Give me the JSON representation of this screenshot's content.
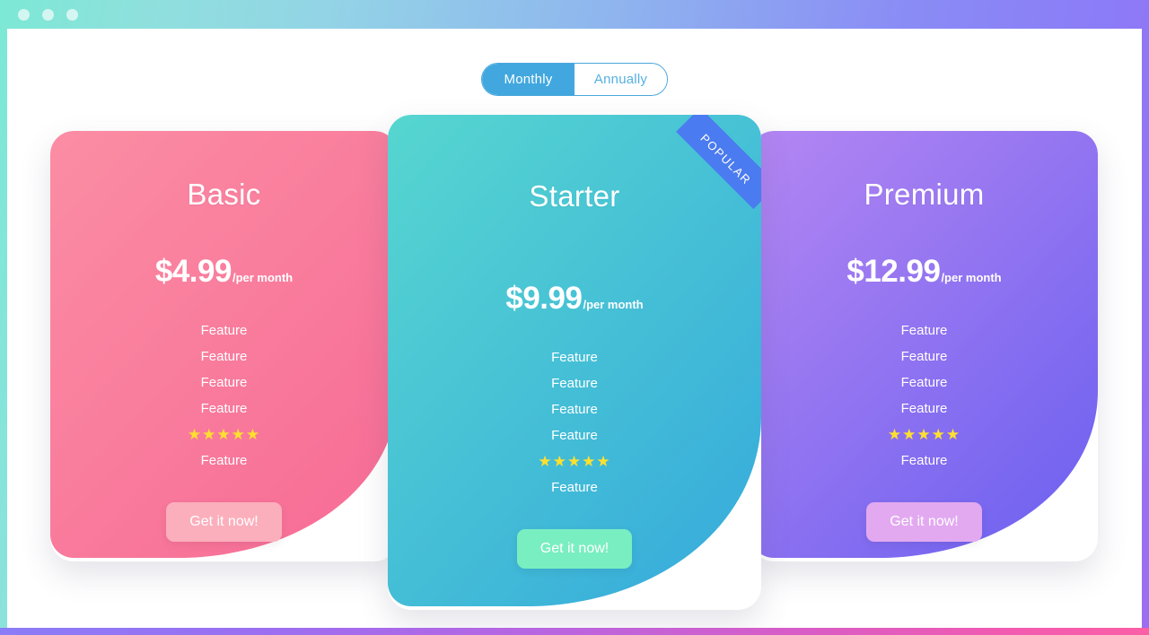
{
  "window": {
    "dots": [
      "close-dot",
      "minimize-dot",
      "maximize-dot"
    ],
    "chrome_gradient_start": "#7ce8d5",
    "chrome_gradient_end": "#9b6ef0",
    "bottom_strip_start": "#8b7cf7",
    "bottom_strip_end": "#fb5fa6"
  },
  "billing_toggle": {
    "options": [
      {
        "label": "Monthly",
        "active": true
      },
      {
        "label": "Annually",
        "active": false
      }
    ],
    "active_color": "#41a7de",
    "inactive_text_color": "#55b0e0"
  },
  "ribbon": {
    "label": "POPULAR",
    "color": "#4a7bf0",
    "text_color": "#ffffff"
  },
  "plans": [
    {
      "id": "basic",
      "title": "Basic",
      "price": "$4.99",
      "period": "/per month",
      "features": [
        "Feature",
        "Feature",
        "Feature",
        "Feature"
      ],
      "rating_stars": 5,
      "star_glyph": "★",
      "feature_after_rating": "Feature",
      "cta_label": "Get it now!",
      "blob_color_start": "#fb8da4",
      "blob_color_end": "#f76d96",
      "cta_color": "#fbafbc",
      "popular": false
    },
    {
      "id": "starter",
      "title": "Starter",
      "price": "$9.99",
      "period": "/per month",
      "features": [
        "Feature",
        "Feature",
        "Feature",
        "Feature"
      ],
      "rating_stars": 5,
      "star_glyph": "★",
      "feature_after_rating": "Feature",
      "cta_label": "Get it now!",
      "blob_color_start": "#56d6d0",
      "blob_color_end": "#37acdb",
      "cta_color": "#79eec1",
      "popular": true
    },
    {
      "id": "premium",
      "title": "Premium",
      "price": "$12.99",
      "period": "/per month",
      "features": [
        "Feature",
        "Feature",
        "Feature",
        "Feature"
      ],
      "rating_stars": 5,
      "star_glyph": "★",
      "feature_after_rating": "Feature",
      "cta_label": "Get it now!",
      "blob_color_start": "#b486f2",
      "blob_color_end": "#6f62f0",
      "cta_color": "#e2a9f0",
      "popular": false
    }
  ]
}
